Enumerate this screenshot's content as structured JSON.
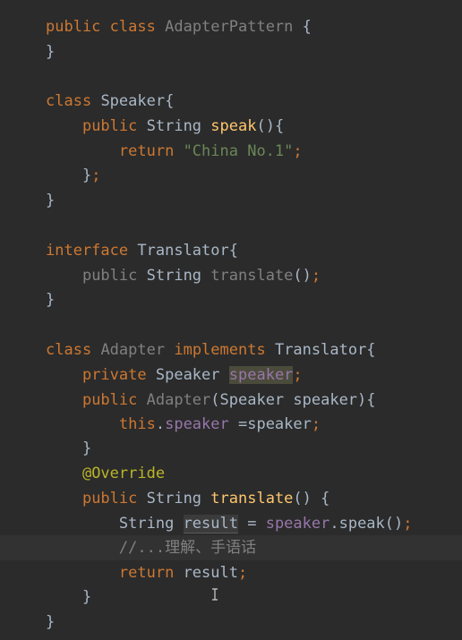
{
  "editor": {
    "colors": {
      "background": "#2b2b2b",
      "keyword": "#cc7832",
      "string": "#6a8759",
      "method_declaration": "#ffc66d",
      "field": "#9876aa",
      "annotation": "#bbb529",
      "comment": "#808080",
      "plain": "#a9b7c6"
    },
    "code": {
      "l1": {
        "kw1": "public",
        "kw2": "class",
        "name": "AdapterPattern",
        "brace": "{"
      },
      "l2": {
        "brace": "}"
      },
      "l4": {
        "kw": "class",
        "name": "Speaker{"
      },
      "l5": {
        "kw": "public",
        "type": "String",
        "method": "speak",
        "rest": "(){"
      },
      "l6": {
        "kw": "return",
        "string": "\"China No.1\"",
        "semi": ";"
      },
      "l7": {
        "brace": "}",
        "semi": ";"
      },
      "l8": {
        "brace": "}"
      },
      "l10": {
        "kw": "interface",
        "name": "Translator{"
      },
      "l11": {
        "kw": "public",
        "type": "String",
        "method": "translate",
        "rest": "()",
        "semi": ";"
      },
      "l12": {
        "brace": "}"
      },
      "l14": {
        "kw1": "class",
        "name": "Adapter",
        "kw2": "implements",
        "iface": "Translator{"
      },
      "l15": {
        "kw": "private",
        "type": "Speaker",
        "field": "speaker",
        "semi": ";"
      },
      "l16": {
        "kw": "public",
        "ctor": "Adapter",
        "params": "(Speaker speaker){"
      },
      "l17": {
        "kw": "this",
        "dot": ".",
        "field": "speaker",
        "rest": " =speaker",
        "semi": ";"
      },
      "l18": {
        "brace": "}"
      },
      "l19": {
        "annotation": "@Override"
      },
      "l20": {
        "kw": "public",
        "type": "String",
        "method": "translate",
        "rest": "() {"
      },
      "l21": {
        "type": "String",
        "var": "result",
        "eq": " = ",
        "field": "speaker",
        "call": ".speak()",
        "semi": ";"
      },
      "l22": {
        "comment": "//...理解、手语话"
      },
      "l23": {
        "kw": "return",
        "var": "result",
        "semi": ";"
      },
      "l24": {
        "brace": "}"
      },
      "l25": {
        "brace": "}"
      }
    },
    "text_cursor_icon": "i-beam-cursor-icon"
  }
}
